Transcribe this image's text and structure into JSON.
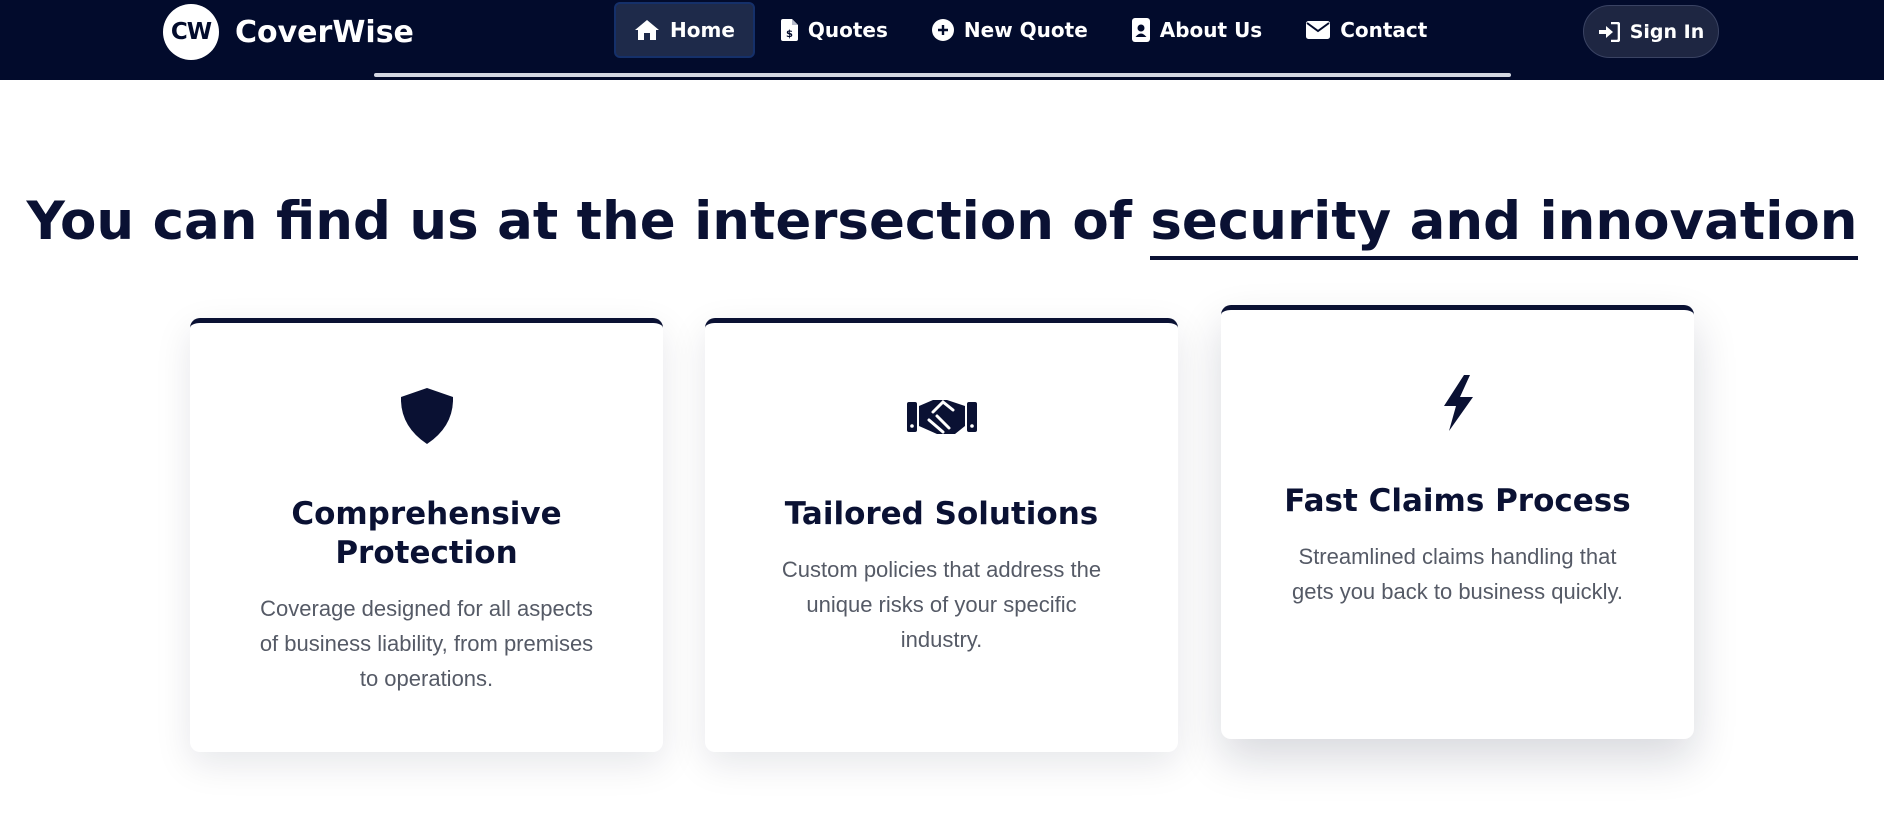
{
  "brand": {
    "logo_text": "CW",
    "name": "CoverWise"
  },
  "nav": {
    "items": [
      {
        "label": "Home",
        "icon": "home-icon",
        "active": true
      },
      {
        "label": "Quotes",
        "icon": "file-invoice-dollar-icon",
        "active": false
      },
      {
        "label": "New Quote",
        "icon": "plus-circle-icon",
        "active": false
      },
      {
        "label": "About Us",
        "icon": "address-card-icon",
        "active": false
      },
      {
        "label": "Contact",
        "icon": "envelope-icon",
        "active": false
      }
    ],
    "signin_label": "Sign In",
    "signin_icon": "sign-in-icon"
  },
  "hero": {
    "headline_prefix": "You can find us at the intersection of ",
    "headline_highlight": "security and innovation"
  },
  "features": [
    {
      "icon": "shield-icon",
      "title": "Comprehensive Protection",
      "description": "Coverage designed for all aspects of business liability, from premises to operations."
    },
    {
      "icon": "handshake-icon",
      "title": "Tailored Solutions",
      "description": "Custom policies that address the unique risks of your specific industry."
    },
    {
      "icon": "bolt-icon",
      "title": "Fast Claims Process",
      "description": "Streamlined claims handling that gets you back to business quickly."
    }
  ],
  "colors": {
    "navy": "#020b2c",
    "text_dark": "#0a1133",
    "text_muted": "#555a66",
    "active_nav_bg": "#1e2a4a"
  }
}
